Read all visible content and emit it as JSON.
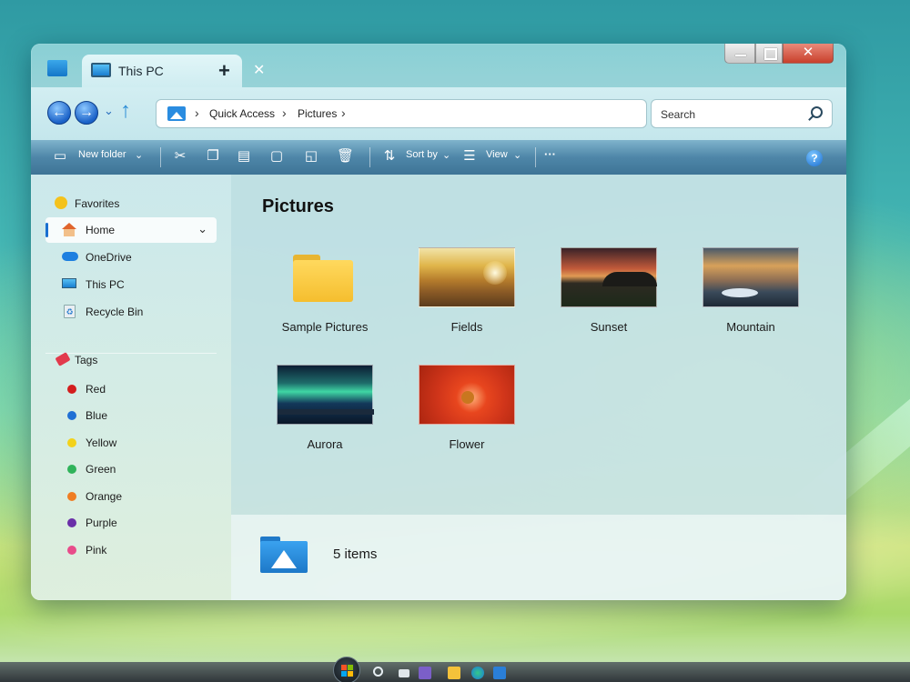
{
  "window": {
    "tab_title": "This PC",
    "new_tab": "+",
    "close_tab": "✕",
    "close_button": "✕"
  },
  "address": {
    "crumbs": [
      "Quick Access",
      "Pictures"
    ],
    "separator": "›",
    "search_placeholder": "Search"
  },
  "toolbar": {
    "new_folder": "New folder",
    "sort_by": "Sort by",
    "view": "View",
    "more": "···",
    "help": "?"
  },
  "sidebar": {
    "favorites": "Favorites",
    "items": [
      {
        "label": "Home",
        "icon": "home-icon"
      },
      {
        "label": "OneDrive",
        "icon": "cloud-icon"
      },
      {
        "label": "This PC",
        "icon": "computer-icon"
      },
      {
        "label": "Recycle Bin",
        "icon": "recycle-bin-icon"
      }
    ],
    "tags_header": "Tags",
    "tags": [
      {
        "label": "Red",
        "color": "#d31d1d"
      },
      {
        "label": "Blue",
        "color": "#1f6fd4"
      },
      {
        "label": "Yellow",
        "color": "#f3d21a"
      },
      {
        "label": "Green",
        "color": "#2fb35a"
      },
      {
        "label": "Orange",
        "color": "#ef7d22"
      },
      {
        "label": "Purple",
        "color": "#6a2fa8"
      },
      {
        "label": "Pink",
        "color": "#e84c8a"
      }
    ]
  },
  "content": {
    "title": "Pictures",
    "items": [
      {
        "label": "Sample Pictures",
        "type": "folder"
      },
      {
        "label": "Fields",
        "type": "image"
      },
      {
        "label": "Sunset",
        "type": "image"
      },
      {
        "label": "Mountain",
        "type": "image"
      },
      {
        "label": "Aurora",
        "type": "image"
      },
      {
        "label": "Flower",
        "type": "image"
      }
    ]
  },
  "status": {
    "count": "5 items"
  }
}
